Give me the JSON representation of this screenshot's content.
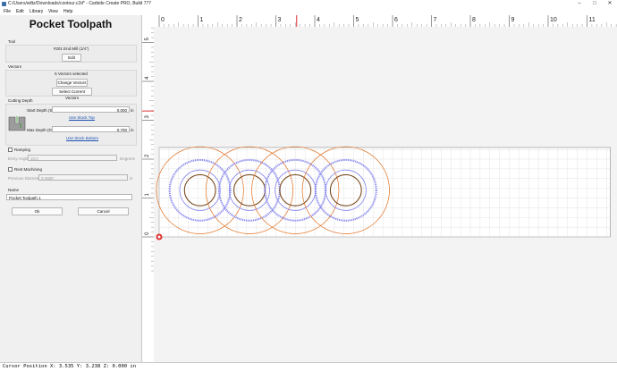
{
  "window": {
    "title": "C:/Users/wiltz/Downloads/contour.c2d* - Carbide Create PRO, Build 777",
    "minimize": "–",
    "maximize": "□",
    "close": "✕"
  },
  "menu": [
    "File",
    "Edit",
    "Library",
    "View",
    "Help"
  ],
  "panel": {
    "title": "Pocket Toolpath",
    "tool": {
      "label": "Tool",
      "name": "#201 End Mill (1/4\")",
      "edit": "Edit"
    },
    "vectors": {
      "label": "Vectors",
      "count": "5 Vectors selected",
      "change": "Change Vectors",
      "select": "Select Current Vectors"
    },
    "depth": {
      "label": "Cutting Depth",
      "start_label": "Start Depth (S)",
      "start_value": "0.000",
      "unit": "in",
      "use_top": "Use Stock Top",
      "max_label": "Max Depth (D)",
      "max_value": "0.700",
      "use_bottom": "Use Stock Bottom"
    },
    "ramping": {
      "label": "Ramping",
      "angle_label": "Entry Angle",
      "angle_value": "10.0",
      "angle_unit": "Degrees"
    },
    "rest": {
      "label": "Rest Machining",
      "prev_label": "Previous Diameter",
      "prev_value": "0.2500",
      "prev_unit": "in"
    },
    "name": {
      "label": "Name",
      "value": "Pocket Toolpath 1"
    },
    "ok": "Ok",
    "cancel": "Cancel"
  },
  "ruler": {
    "h_labels": [
      "0",
      "1",
      "2",
      "3",
      "4",
      "5",
      "6",
      "7",
      "8",
      "9",
      "10",
      "11"
    ],
    "v_labels": [
      "0",
      "1",
      "2",
      "3",
      "4",
      "5"
    ],
    "cursor_x": 3.535,
    "cursor_y": 3.238
  },
  "colors": {
    "outer": "#e07020",
    "inner": "#7a4a20",
    "mid": "#8888ee",
    "grid": "#dddddd",
    "cursor": "#e03030"
  },
  "status": "Cursor Position X: 3.535 Y: 3.238 Z: 0.000 in"
}
